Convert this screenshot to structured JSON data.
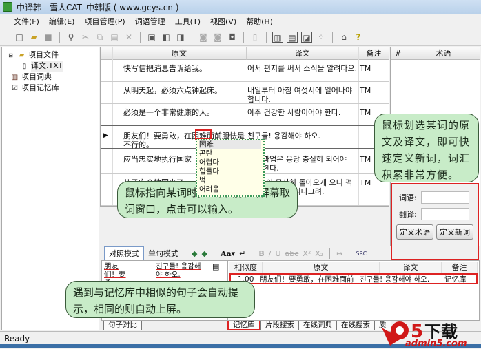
{
  "window": {
    "title": "中译韩 - 雪人CAT_中韩版 ( www.gcys.cn )"
  },
  "menu": [
    "文件(F)",
    "编辑(E)",
    "项目管理(P)",
    "词语管理",
    "工具(T)",
    "视图(V)",
    "帮助(H)"
  ],
  "tree": {
    "items": [
      {
        "label": "项目文件",
        "icon": "folder-icon"
      },
      {
        "label": "译文.TXT",
        "icon": "file-icon"
      },
      {
        "label": "项目词典",
        "icon": "dictionary-icon"
      },
      {
        "label": "项目记忆库",
        "icon": "memory-icon"
      }
    ]
  },
  "grid": {
    "headers": [
      "原文",
      "译文",
      "备注"
    ],
    "rows": [
      {
        "src": "快写信把消息告诉给我。",
        "tgt": "어서 편지를 써서 소식을 알려다오.",
        "note": "TM"
      },
      {
        "src": "从明天起，必须六点钟起床。",
        "tgt": "내일부터 아침 여섯시에 일어나야 합니다.",
        "note": "TM"
      },
      {
        "src": "必须是一个非常健康的人。",
        "tgt": "아주 건강한 사람이어야 한다.",
        "note": "TM"
      },
      {
        "src": "朋友们！要勇敢，在困难面前胆怯是不行的。",
        "tgt": "친구들! 용감해야 하오.",
        "note": ""
      },
      {
        "src": "应当忠实地执行国家",
        "tgt": "과업은 응당 충실히 되어야 한다.",
        "note": "TM"
      },
      {
        "src": "儿子安全地回来了，高兴了。",
        "tgt": "이 무사히 돌아오게 으니 퍽 하시겠습니다그려.",
        "note": "TM"
      }
    ]
  },
  "popup": {
    "items": [
      "困难",
      "곤란",
      "어렵다",
      "힘들다",
      "벅",
      "어려움"
    ]
  },
  "terms": {
    "headers": [
      "#",
      "术语"
    ],
    "word_label": "词语:",
    "trans_label": "翻译:",
    "word_value": "",
    "trans_value": "",
    "define_term": "定义术语",
    "define_word": "定义新词"
  },
  "callouts": {
    "right": "鼠标划选某词的原文及译文，即可快速定义新词，词汇积累非常方便。",
    "middle": "鼠标指向某词时，会自动弹出屏幕取词窗口，点击可以输入。",
    "bottom": "遇到与记忆库中相似的句子会自动提示，相同的则自动上屏。"
  },
  "bottom_toolbar": {
    "mode_compare": "对照模式",
    "mode_single": "单句模式",
    "font": "Aa▾"
  },
  "compare": {
    "src": "朋友们！要勇",
    "tgt": "친구들! 용감해야 하오.",
    "tab": "句子对比"
  },
  "memory": {
    "headers": [
      "相似度",
      "原文",
      "译文",
      "备注"
    ],
    "rows": [
      {
        "score": "1.00",
        "src": "朋友们！要勇敢，在困难面前",
        "tgt": "친구들! 용감해야 하오.",
        "note": "记忆库"
      }
    ]
  },
  "bottom_tabs": [
    "记忆库",
    "片段搜索",
    "在线词典",
    "在线搜索",
    "质"
  ],
  "status": "Ready",
  "logo": {
    "text": "a5下载",
    "sub": "admin5.com"
  }
}
